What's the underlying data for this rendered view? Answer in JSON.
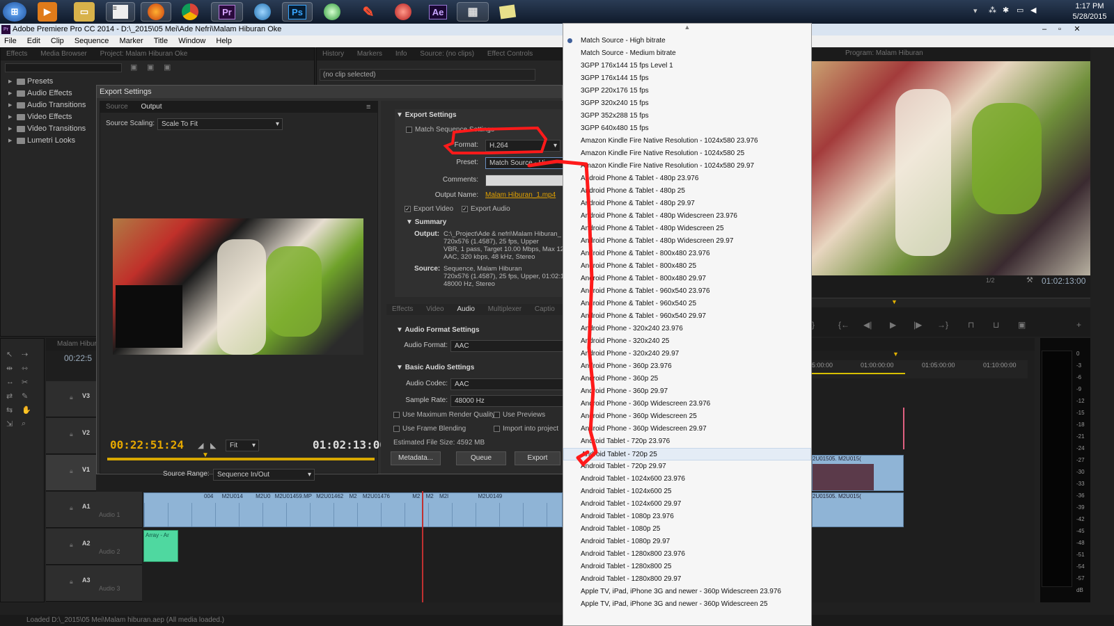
{
  "taskbar": {
    "icons": [
      "start-orb",
      "media-player",
      "explorer",
      "notepad",
      "firefox",
      "chrome",
      "premiere",
      "globe",
      "photoshop",
      "maps",
      "app-red",
      "app-round",
      "after-effects",
      "film-app",
      "notes"
    ],
    "pr_label": "Pr",
    "ps_label": "Ps",
    "ae_label": "Ae",
    "time": "1:17 PM",
    "date": "5/28/2015"
  },
  "app": {
    "title": "Adobe Premiere Pro CC 2014 - D:\\_2015\\05 Mei\\Ade Nefri\\Malam Hiburan Oke",
    "menu": [
      "File",
      "Edit",
      "Clip",
      "Sequence",
      "Marker",
      "Title",
      "Window",
      "Help"
    ]
  },
  "effects_panel": {
    "tabs": [
      "Effects",
      "Media Browser",
      "Project: Malam Hiburan Oke"
    ],
    "items": [
      "Presets",
      "Audio Effects",
      "Audio Transitions",
      "Video Effects",
      "Video Transitions",
      "Lumetri Looks"
    ]
  },
  "source_panel": {
    "tabs": [
      "History",
      "Markers",
      "Info",
      "Source: (no clips)",
      "Effect Controls"
    ],
    "no_clip": "(no clip selected)"
  },
  "export": {
    "title": "Export Settings",
    "tabs": [
      "Source",
      "Output"
    ],
    "source_scaling_label": "Source Scaling:",
    "source_scaling": "Scale To Fit",
    "export_settings": "Export Settings",
    "match_sequence": "Match Sequence Settings",
    "format_label": "Format:",
    "format": "H.264",
    "preset_label": "Preset:",
    "preset": "Match Source - Hi",
    "comments_label": "Comments:",
    "output_name_label": "Output Name:",
    "output_name": "Malam Hiburan_1.mp4",
    "export_video": "Export Video",
    "export_audio": "Export Audio",
    "summary": "Summary",
    "output_label": "Output:",
    "output_lines": [
      "C:\\_Project\\Ade & nefri\\Malam Hiburan_",
      "720x576 (1.4587), 25 fps, Upper",
      "VBR, 1 pass, Target 10.00 Mbps, Max 12",
      "AAC, 320 kbps, 48 kHz, Stereo"
    ],
    "source_label": "Source:",
    "source_lines": [
      "Sequence, Malam Hiburan",
      "720x576 (1.4587), 25 fps, Upper, 01:02:1",
      "48000 Hz, Stereo"
    ],
    "settings_tabs": [
      "Effects",
      "Video",
      "Audio",
      "Multiplexer",
      "Captio"
    ],
    "audio_format_settings": "Audio Format Settings",
    "audio_format_label": "Audio Format:",
    "audio_format": "AAC",
    "basic_audio": "Basic Audio Settings",
    "audio_codec_label": "Audio Codec:",
    "audio_codec": "AAC",
    "sample_rate_label": "Sample Rate:",
    "sample_rate": "48000 Hz",
    "max_render": "Use Maximum Render Quality",
    "use_previews": "Use Previews",
    "frame_blending": "Use Frame Blending",
    "import_project": "Import into project",
    "file_size": "Estimated File Size:  4592 MB",
    "metadata": "Metadata...",
    "queue": "Queue",
    "export": "Export",
    "timecode_in": "00:22:51:24",
    "timecode_out": "01:02:13:00",
    "fit": "Fit",
    "source_range_label": "Source Range:",
    "source_range": "Sequence In/Out"
  },
  "dropdown": {
    "items": [
      "Match Source - High bitrate",
      "Match Source - Medium bitrate",
      "3GPP 176x144 15 fps Level 1",
      "3GPP 176x144 15 fps",
      "3GPP 220x176 15 fps",
      "3GPP 320x240 15 fps",
      "3GPP 352x288 15 fps",
      "3GPP 640x480 15 fps",
      "Amazon Kindle Fire Native Resolution - 1024x580 23.976",
      "Amazon Kindle Fire Native Resolution - 1024x580 25",
      "Amazon Kindle Fire Native Resolution - 1024x580 29.97",
      "Android Phone & Tablet - 480p 23.976",
      "Android Phone & Tablet - 480p 25",
      "Android Phone & Tablet - 480p 29.97",
      "Android Phone & Tablet - 480p Widescreen 23.976",
      "Android Phone & Tablet - 480p Widescreen 25",
      "Android Phone & Tablet - 480p Widescreen 29.97",
      "Android Phone & Tablet - 800x480 23.976",
      "Android Phone & Tablet - 800x480 25",
      "Android Phone & Tablet - 800x480 29.97",
      "Android Phone & Tablet - 960x540 23.976",
      "Android Phone & Tablet - 960x540 25",
      "Android Phone & Tablet - 960x540 29.97",
      "Android Phone - 320x240 23.976",
      "Android Phone - 320x240 25",
      "Android Phone - 320x240 29.97",
      "Android Phone - 360p 23.976",
      "Android Phone - 360p 25",
      "Android Phone - 360p 29.97",
      "Android Phone - 360p Widescreen 23.976",
      "Android Phone - 360p Widescreen 25",
      "Android Phone - 360p Widescreen 29.97",
      "Android Tablet - 720p 23.976",
      "Android Tablet - 720p 25",
      "Android Tablet - 720p 29.97",
      "Android Tablet - 1024x600 23.976",
      "Android Tablet - 1024x600 25",
      "Android Tablet - 1024x600 29.97",
      "Android Tablet - 1080p 23.976",
      "Android Tablet - 1080p 25",
      "Android Tablet - 1080p 29.97",
      "Android Tablet - 1280x800 23.976",
      "Android Tablet - 1280x800 25",
      "Android Tablet - 1280x800 29.97",
      "Apple TV, iPad, iPhone 3G and newer - 360p Widescreen 23.976",
      "Apple TV, iPad, iPhone 3G and newer - 360p Widescreen 25"
    ],
    "selected_index": 0,
    "highlighted_index": 33
  },
  "program": {
    "tab": "Program: Malam Hiburan",
    "timecode": "01:02:13:00",
    "zoom": "1/2"
  },
  "timeline": {
    "tab": "Malam Hiburan",
    "timecode": "00:22:5",
    "ruler": [
      "5:00:00",
      "01:00:00:00",
      "01:05:00:00",
      "01:10:00:00"
    ],
    "tracks": [
      {
        "id": "V3",
        "name": ""
      },
      {
        "id": "V2",
        "name": ""
      },
      {
        "id": "V1",
        "name": ""
      },
      {
        "id": "A1",
        "name": "Audio 1"
      },
      {
        "id": "A2",
        "name": "Audio 2"
      },
      {
        "id": "A3",
        "name": "Audio 3"
      }
    ],
    "clips_a1": [
      "004",
      "M2U014",
      "M2U0",
      "M2U01459.MP",
      "M2U01462",
      "M2",
      "M2U01476",
      "M2",
      "M2",
      "M2I",
      "M2U0149"
    ],
    "clips_right": [
      "2U01505.",
      "M2U015("
    ],
    "audio_clip": "Array - Ar",
    "meter_scale": [
      "0",
      "-3",
      "-6",
      "-9",
      "-12",
      "-15",
      "-18",
      "-21",
      "-24",
      "-27",
      "-30",
      "-33",
      "-36",
      "-39",
      "-42",
      "-45",
      "-48",
      "-51",
      "-54",
      "-57",
      "dB"
    ]
  },
  "status": "Loaded D:\\_2015\\05 Mei\\Malam hiburan.aep (All media loaded.)"
}
